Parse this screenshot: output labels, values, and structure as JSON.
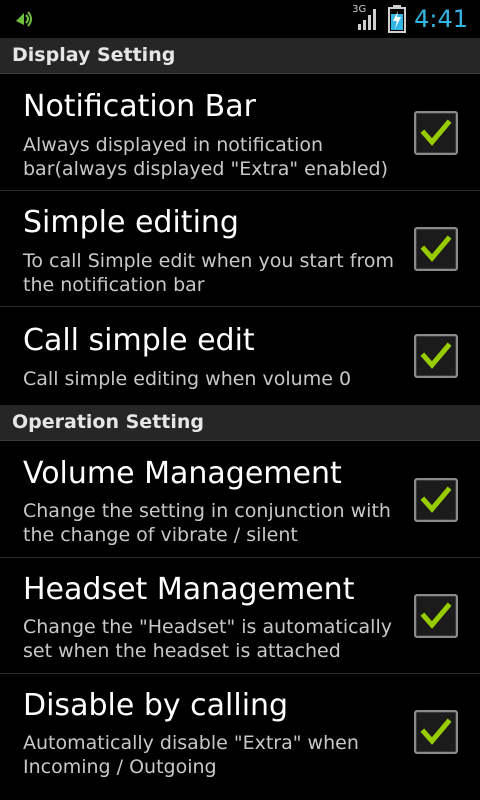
{
  "status_bar": {
    "network_label": "3G",
    "time": "4:41",
    "accent_color": "#33b5e5"
  },
  "sections": [
    {
      "header": "Display Setting",
      "items": [
        {
          "title": "Notification Bar",
          "summary": "Always displayed in notification bar(always displayed \"Extra\" enabled)",
          "checked": true
        },
        {
          "title": "Simple editing",
          "summary": "To call Simple edit when you start from the notification bar",
          "checked": true
        },
        {
          "title": "Call simple edit",
          "summary": "Call simple editing when volume 0",
          "checked": true
        }
      ]
    },
    {
      "header": "Operation Setting",
      "items": [
        {
          "title": "Volume Management",
          "summary": "Change the setting in conjunction with the change of vibrate / silent",
          "checked": true
        },
        {
          "title": "Headset Management",
          "summary": "Change the \"Headset\" is automatically set when the headset is attached",
          "checked": true
        },
        {
          "title": "Disable by calling",
          "summary": "Automatically disable \"Extra\" when Incoming / Outgoing",
          "checked": true
        }
      ]
    }
  ]
}
